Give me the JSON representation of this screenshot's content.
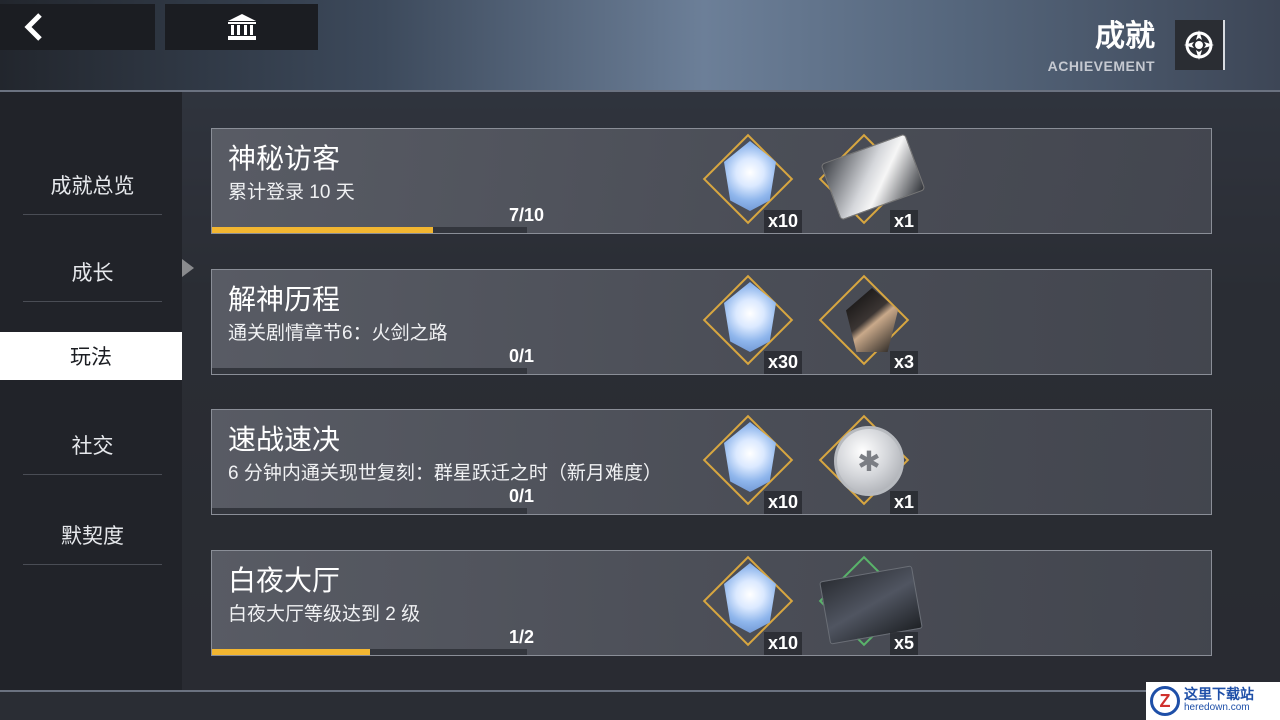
{
  "header": {
    "title": "成就",
    "subtitle": "ACHIEVEMENT",
    "back_icon": "chevron-left-icon",
    "home_icon": "museum-icon",
    "settings_icon": "gear-compass-icon"
  },
  "sidebar": {
    "items": [
      {
        "label": "成就总览",
        "active": false
      },
      {
        "label": "成长",
        "active": false
      },
      {
        "label": "玩法",
        "active": true
      },
      {
        "label": "社交",
        "active": false
      },
      {
        "label": "默契度",
        "active": false
      }
    ]
  },
  "achievements": [
    {
      "title": "神秘访客",
      "desc": "累计登录 10 天",
      "progress_text": "7/10",
      "progress": 0.7,
      "rewards": [
        {
          "icon": "crystal-icon",
          "count": "x10"
        },
        {
          "icon": "karma-card-icon",
          "count": "x1"
        }
      ]
    },
    {
      "title": "解神历程",
      "desc": "通关剧情章节6：火剑之路",
      "progress_text": "0/1",
      "progress": 0,
      "rewards": [
        {
          "icon": "crystal-icon",
          "count": "x30"
        },
        {
          "icon": "black-gem-icon",
          "count": "x3"
        }
      ]
    },
    {
      "title": "速战速决",
      "desc": "6 分钟内通关现世复刻：群星跃迁之时（新月难度）",
      "progress_text": "0/1",
      "progress": 0,
      "rewards": [
        {
          "icon": "crystal-icon",
          "count": "x10"
        },
        {
          "icon": "proserpine-coin-icon",
          "count": "x1"
        }
      ]
    },
    {
      "title": "白夜大厅",
      "desc": "白夜大厅等级达到 2 级",
      "progress_text": "1/2",
      "progress": 0.5,
      "rewards": [
        {
          "icon": "crystal-icon",
          "count": "x10"
        },
        {
          "icon": "accelerator-card-icon",
          "count": "x5"
        }
      ]
    }
  ],
  "watermark": {
    "cn": "这里下载站",
    "en": "heredown.com",
    "logo": "Z"
  },
  "colors": {
    "progress": "#f2b631",
    "accent_gold": "#d7a640"
  }
}
